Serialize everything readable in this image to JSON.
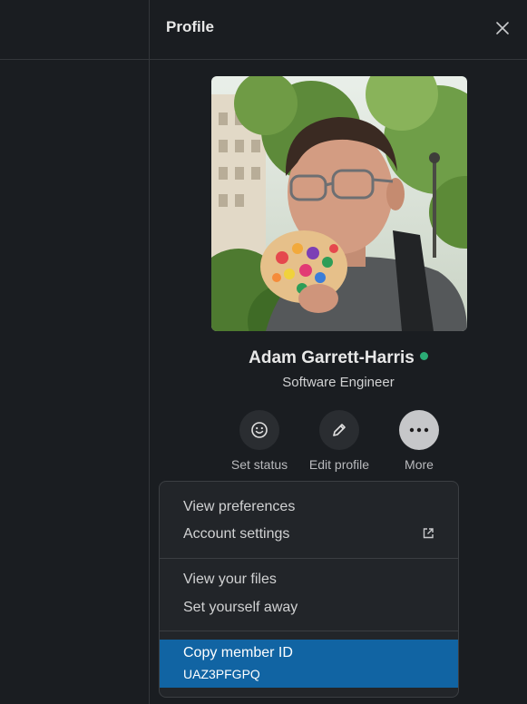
{
  "panel": {
    "title": "Profile"
  },
  "profile": {
    "name": "Adam Garrett-Harris",
    "title": "Software Engineer",
    "status_color": "#2bac76"
  },
  "actions": [
    {
      "label": "Set status",
      "icon": "smiley-icon"
    },
    {
      "label": "Edit profile",
      "icon": "pencil-icon"
    },
    {
      "label": "More",
      "icon": "more-horizontal-icon",
      "active": true
    }
  ],
  "menu": {
    "items": [
      {
        "label": "View preferences"
      },
      {
        "label": "Account settings",
        "icon": "external-link-icon"
      },
      {
        "label": "View your files"
      },
      {
        "label": "Set yourself away"
      },
      {
        "label": "Copy member ID",
        "sub": "UAZ3PFGPQ",
        "highlighted": true
      }
    ]
  },
  "colors": {
    "background": "#1a1d21",
    "highlight": "#1164a3",
    "presence": "#2bac76"
  }
}
